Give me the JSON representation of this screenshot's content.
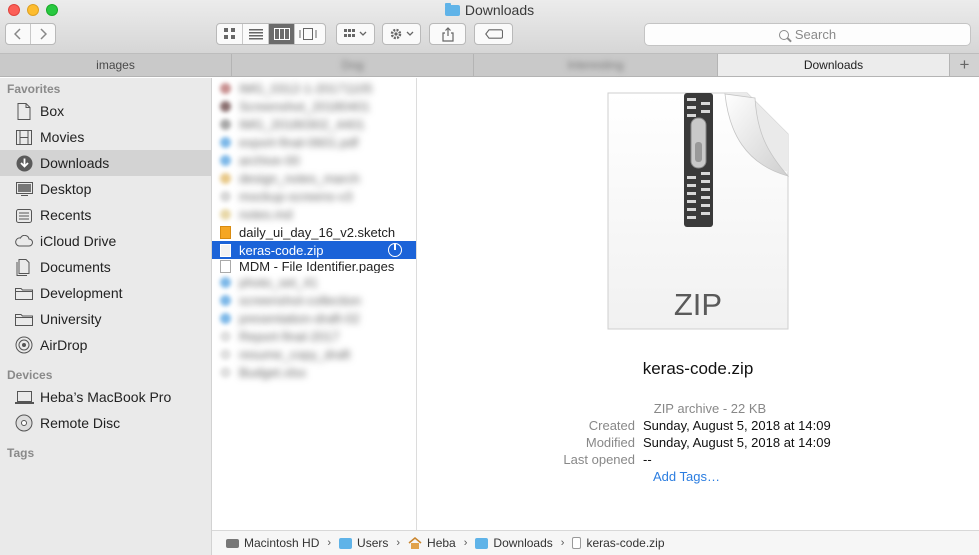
{
  "window": {
    "title": "Downloads"
  },
  "toolbar": {
    "search_placeholder": "Search"
  },
  "tabs": [
    {
      "label": "images",
      "blurred": false
    },
    {
      "label": "Dog",
      "blurred": true
    },
    {
      "label": "Interesting",
      "blurred": true
    },
    {
      "label": "Downloads",
      "blurred": false
    }
  ],
  "sidebar": {
    "favorites_header": "Favorites",
    "favorites": [
      {
        "label": "Box",
        "icon": "document-icon"
      },
      {
        "label": "Movies",
        "icon": "film-icon"
      },
      {
        "label": "Downloads",
        "icon": "download-icon",
        "selected": true
      },
      {
        "label": "Desktop",
        "icon": "desktop-icon"
      },
      {
        "label": "Recents",
        "icon": "recents-icon"
      },
      {
        "label": "iCloud Drive",
        "icon": "cloud-icon"
      },
      {
        "label": "Documents",
        "icon": "documents-icon"
      },
      {
        "label": "Development",
        "icon": "folder-icon"
      },
      {
        "label": "University",
        "icon": "folder-icon"
      },
      {
        "label": "AirDrop",
        "icon": "airdrop-icon"
      }
    ],
    "devices_header": "Devices",
    "devices": [
      {
        "label": "Heba’s MacBook Pro",
        "icon": "laptop-icon"
      },
      {
        "label": "Remote Disc",
        "icon": "disc-icon"
      }
    ],
    "tags_header": "Tags"
  },
  "files": {
    "visible_sketch": "daily_ui_day_16_v2.sketch",
    "selected": "keras-code.zip",
    "partial_next": "MDM - File Identifier.pages"
  },
  "preview": {
    "file_name": "keras-code.zip",
    "icon_label": "ZIP",
    "kind": "ZIP archive - 22 KB",
    "created_label": "Created",
    "created": "Sunday, August 5, 2018 at 14:09",
    "modified_label": "Modified",
    "modified": "Sunday, August 5, 2018 at 14:09",
    "last_opened_label": "Last opened",
    "last_opened": "--",
    "add_tags": "Add Tags…"
  },
  "pathbar": [
    "Macintosh HD",
    "Users",
    "Heba",
    "Downloads",
    "keras-code.zip"
  ]
}
